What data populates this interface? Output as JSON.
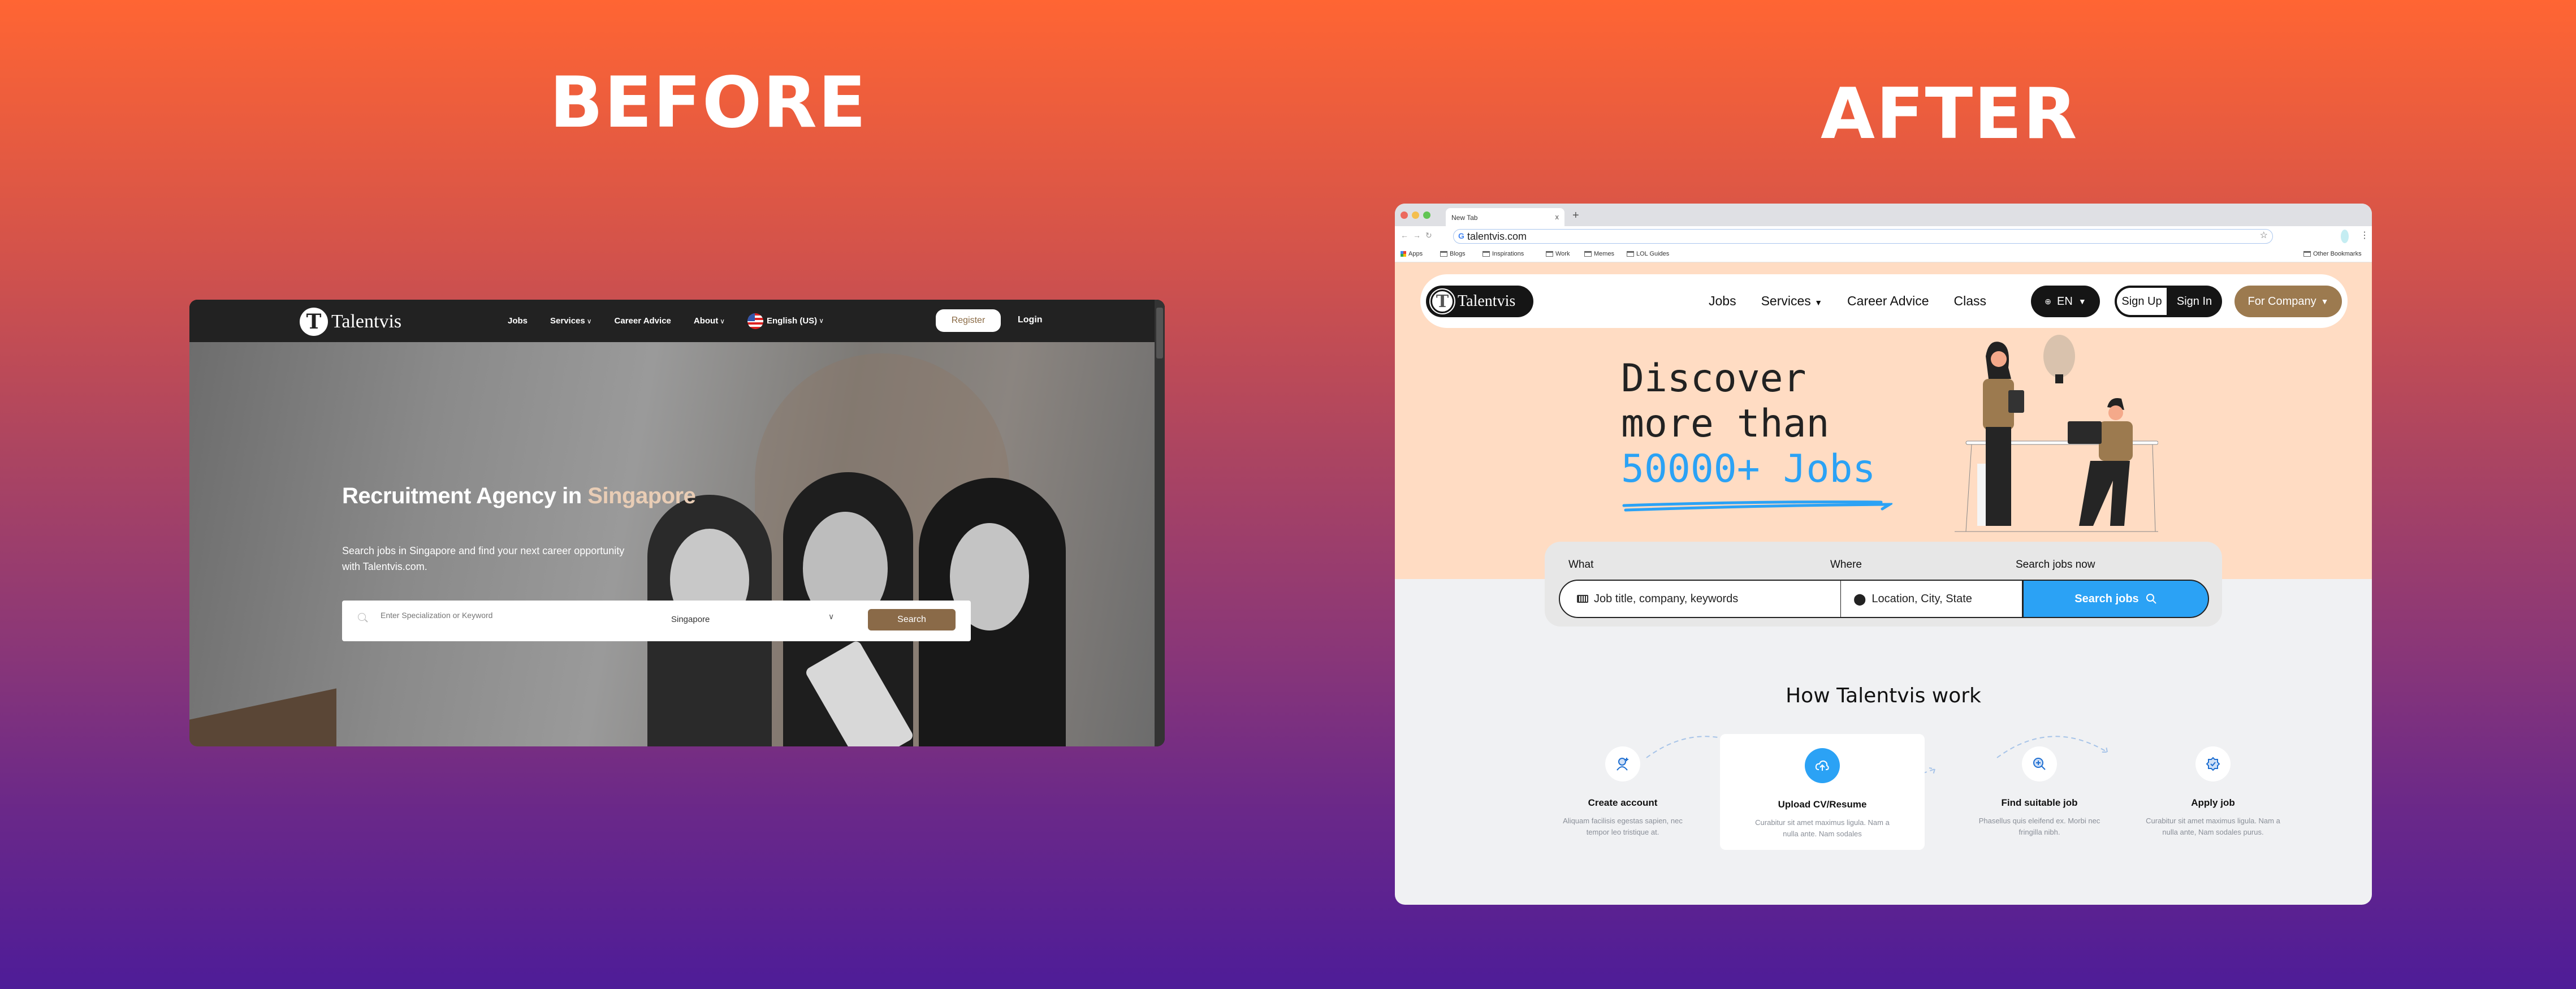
{
  "labels": {
    "before": "BEFORE",
    "after": "AFTER"
  },
  "before": {
    "nav": {
      "logo_letter": "T",
      "logo_text": "Talentvis",
      "menu": [
        {
          "label": "Jobs",
          "has_dropdown": false
        },
        {
          "label": "Services",
          "has_dropdown": true
        },
        {
          "label": "Career Advice",
          "has_dropdown": false
        },
        {
          "label": "About",
          "has_dropdown": true
        },
        {
          "label": "English (US)",
          "has_dropdown": true,
          "icon": "us-flag-icon"
        }
      ],
      "chevron": "∨",
      "register": "Register",
      "login": "Login"
    },
    "hero": {
      "title_main": "Recruitment Agency in ",
      "title_accent": "Singapore",
      "subtitle": "Search jobs in Singapore and find your next career opportunity with Talentvis.com.",
      "search_placeholder": "Enter Specialization or Keyword",
      "location": "Singapore",
      "chevron": "∨",
      "search_button": "Search"
    },
    "colors": {
      "nav_bg": "#222222",
      "accent": "#8a6a48",
      "title_accent": "#e9cdb5"
    }
  },
  "after": {
    "browser": {
      "tab_title": "New Tab",
      "tab_close": "x",
      "new_tab": "+",
      "nav_arrows": "←→↻",
      "url": "talentvis.com",
      "bookmarks": [
        "Apps",
        "Blogs",
        "Inspirations",
        "Work",
        "Memes",
        "LOL Guides"
      ],
      "other_bookmarks": "Other Bookmarks"
    },
    "nav": {
      "logo_letter": "T",
      "logo_text": "Talentvis",
      "menu": [
        {
          "label": "Jobs",
          "has_dropdown": false
        },
        {
          "label": "Services",
          "has_dropdown": true
        },
        {
          "label": "Career Advice",
          "has_dropdown": false
        },
        {
          "label": "Class",
          "has_dropdown": false
        }
      ],
      "caret": "▼",
      "language": "EN",
      "globe": "🌐",
      "sign_up": "Sign Up",
      "sign_in": "Sign In",
      "for_company": "For Company"
    },
    "hero": {
      "line1": "Discover",
      "line2": "more than",
      "line3": "50000+ Jobs"
    },
    "search": {
      "what_label": "What",
      "where_label": "Where",
      "now_label": "Search jobs now",
      "what_placeholder": "Job title, company, keywords",
      "where_placeholder": "Location, City, State",
      "button": "Search jobs"
    },
    "how": {
      "title": "How Talentvis work",
      "steps": [
        {
          "icon": "add-user-icon",
          "title": "Create account",
          "desc": "Aliquam facilisis egestas sapien, nec tempor leo tristique at."
        },
        {
          "icon": "cloud-upload-icon",
          "title": "Upload CV/Resume",
          "desc": "Curabitur sit amet maximus ligula. Nam a nulla ante. Nam sodales"
        },
        {
          "icon": "search-plus-icon",
          "title": "Find suitable job",
          "desc": "Phasellus quis eleifend ex. Morbi nec fringilla nibh."
        },
        {
          "icon": "verified-badge-icon",
          "title": "Apply job",
          "desc": "Curabitur sit amet maximus ligula. Nam a nulla ante, Nam sodales purus."
        }
      ]
    },
    "colors": {
      "hero_bg": "#ffdcc3",
      "accent_blue": "#2ba2f5",
      "brand_brown": "#9c7a4f",
      "dark": "#151515",
      "page_bg": "#f0f1f3"
    }
  }
}
